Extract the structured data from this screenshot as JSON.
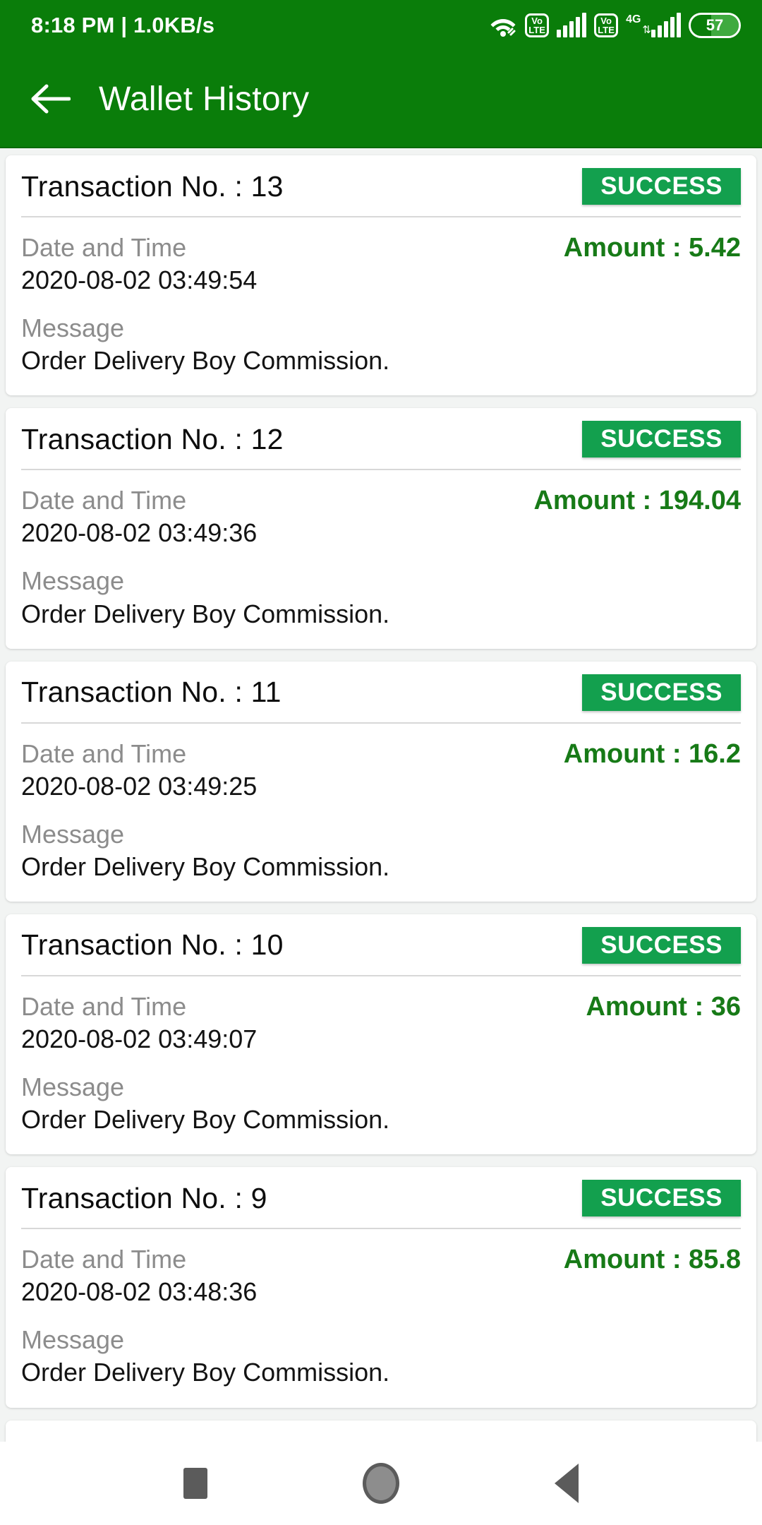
{
  "status_bar": {
    "time": "8:18 PM | 1.0KB/s",
    "icons": [
      {
        "name": "wifi-icon",
        "label": "WiFi"
      },
      {
        "name": "volte-icon-sim1",
        "top": "Vo",
        "bottom": "LTE"
      },
      {
        "name": "signal-bars-icon-sim1",
        "label": "Signal"
      },
      {
        "name": "volte-icon-sim2",
        "top": "Vo",
        "bottom": "LTE"
      },
      {
        "name": "network-4g-icon",
        "label": "4G"
      },
      {
        "name": "signal-bars-icon-sim2",
        "label": "Signal"
      },
      {
        "name": "battery-icon",
        "label": "57"
      }
    ],
    "volte_top": "Vo",
    "volte_bottom": "LTE",
    "network_label": "4G",
    "data_arrows": "⇅",
    "battery_percent": "57"
  },
  "app_bar": {
    "back_label": "←",
    "title": "Wallet History"
  },
  "labels": {
    "date_time": "Date and Time",
    "message": "Message"
  },
  "colors": {
    "app_bar_green": "#0a7d0a",
    "badge_green": "#13a04e",
    "amount_green": "#177a17",
    "muted_gray": "#8c8c8c",
    "page_background": "#f2f4f3"
  },
  "transactions": [
    {
      "title": "Transaction No. : 13",
      "status": "SUCCESS",
      "datetime": "2020-08-02 03:49:54",
      "amount": "Amount : 5.42",
      "message": "Order Delivery Boy Commission."
    },
    {
      "title": "Transaction No. : 12",
      "status": "SUCCESS",
      "datetime": "2020-08-02 03:49:36",
      "amount": "Amount : 194.04",
      "message": "Order Delivery Boy Commission."
    },
    {
      "title": "Transaction No. : 11",
      "status": "SUCCESS",
      "datetime": "2020-08-02 03:49:25",
      "amount": "Amount : 16.2",
      "message": "Order Delivery Boy Commission."
    },
    {
      "title": "Transaction No. : 10",
      "status": "SUCCESS",
      "datetime": "2020-08-02 03:49:07",
      "amount": "Amount : 36",
      "message": "Order Delivery Boy Commission."
    },
    {
      "title": "Transaction No. : 9",
      "status": "SUCCESS",
      "datetime": "2020-08-02 03:48:36",
      "amount": "Amount : 85.8",
      "message": "Order Delivery Boy Commission."
    }
  ],
  "nav_bar": {
    "recents": "recents",
    "home": "home",
    "back": "back"
  }
}
